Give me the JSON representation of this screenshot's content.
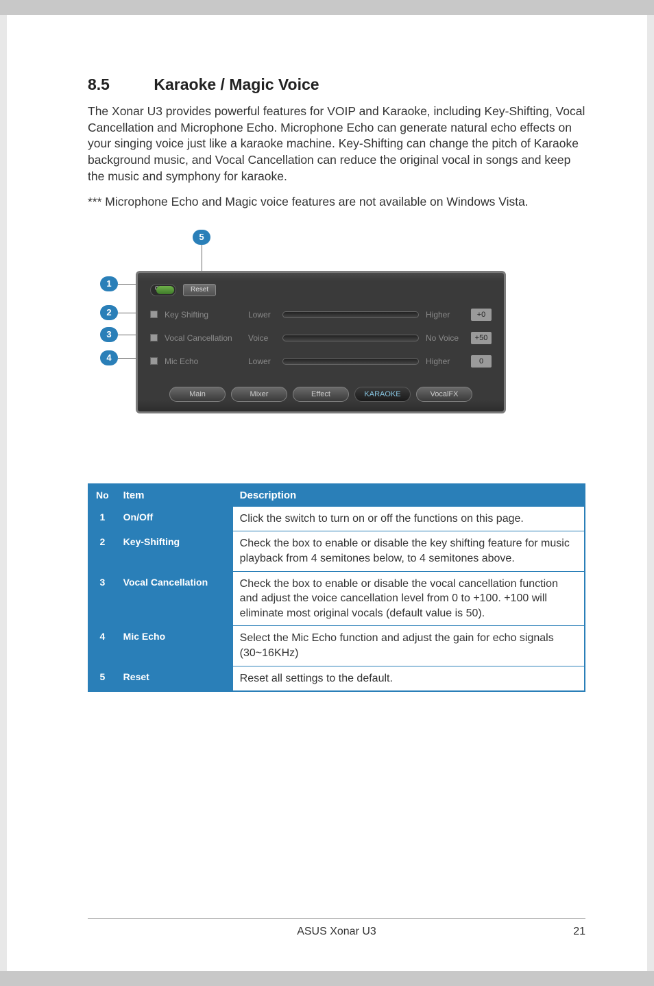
{
  "section": {
    "number": "8.5",
    "title": "Karaoke / Magic Voice"
  },
  "paragraph": "The Xonar U3 provides powerful features for VOIP and Karaoke, including Key-Shifting, Vocal Cancellation and Microphone Echo. Microphone Echo can generate natural echo effects on your singing voice just like a karaoke machine. Key-Shifting can change the pitch of Karaoke background music, and Vocal Cancellation can reduce the original vocal in songs and keep the music and symphony for karaoke.",
  "note": "*** Microphone Echo and Magic voice features are not available on Windows Vista.",
  "callouts": [
    "1",
    "2",
    "3",
    "4",
    "5"
  ],
  "panel": {
    "on_label": "ON",
    "reset": "Reset",
    "rows": [
      {
        "label": "Key Shifting",
        "left": "Lower",
        "right": "Higher",
        "value": "+0"
      },
      {
        "label": "Vocal Cancellation",
        "left": "Voice",
        "right": "No Voice",
        "value": "+50"
      },
      {
        "label": "Mic Echo",
        "left": "Lower",
        "right": "Higher",
        "value": "0"
      }
    ],
    "tabs": [
      "Main",
      "Mixer",
      "Effect",
      "KARAOKE",
      "VocalFX"
    ]
  },
  "table": {
    "headers": [
      "No",
      "Item",
      "Description"
    ],
    "rows": [
      {
        "no": "1",
        "item": "On/Off",
        "desc": "Click the switch to turn on or off the functions on this page."
      },
      {
        "no": "2",
        "item": "Key-Shifting",
        "desc": "Check the box to enable or disable the key shifting feature for music playback from 4 semitones below, to 4 semitones above."
      },
      {
        "no": "3",
        "item": "Vocal Cancellation",
        "desc": "Check the box to enable or disable the vocal cancellation function and adjust the voice cancellation level from 0 to +100. +100 will eliminate most original vocals (default value is 50)."
      },
      {
        "no": "4",
        "item": "Mic Echo",
        "desc": "Select the Mic Echo function and adjust the gain for echo signals (30~16KHz)"
      },
      {
        "no": "5",
        "item": "Reset",
        "desc": "Reset all settings to the default."
      }
    ]
  },
  "footer": {
    "product": "ASUS Xonar U3",
    "page": "21"
  }
}
